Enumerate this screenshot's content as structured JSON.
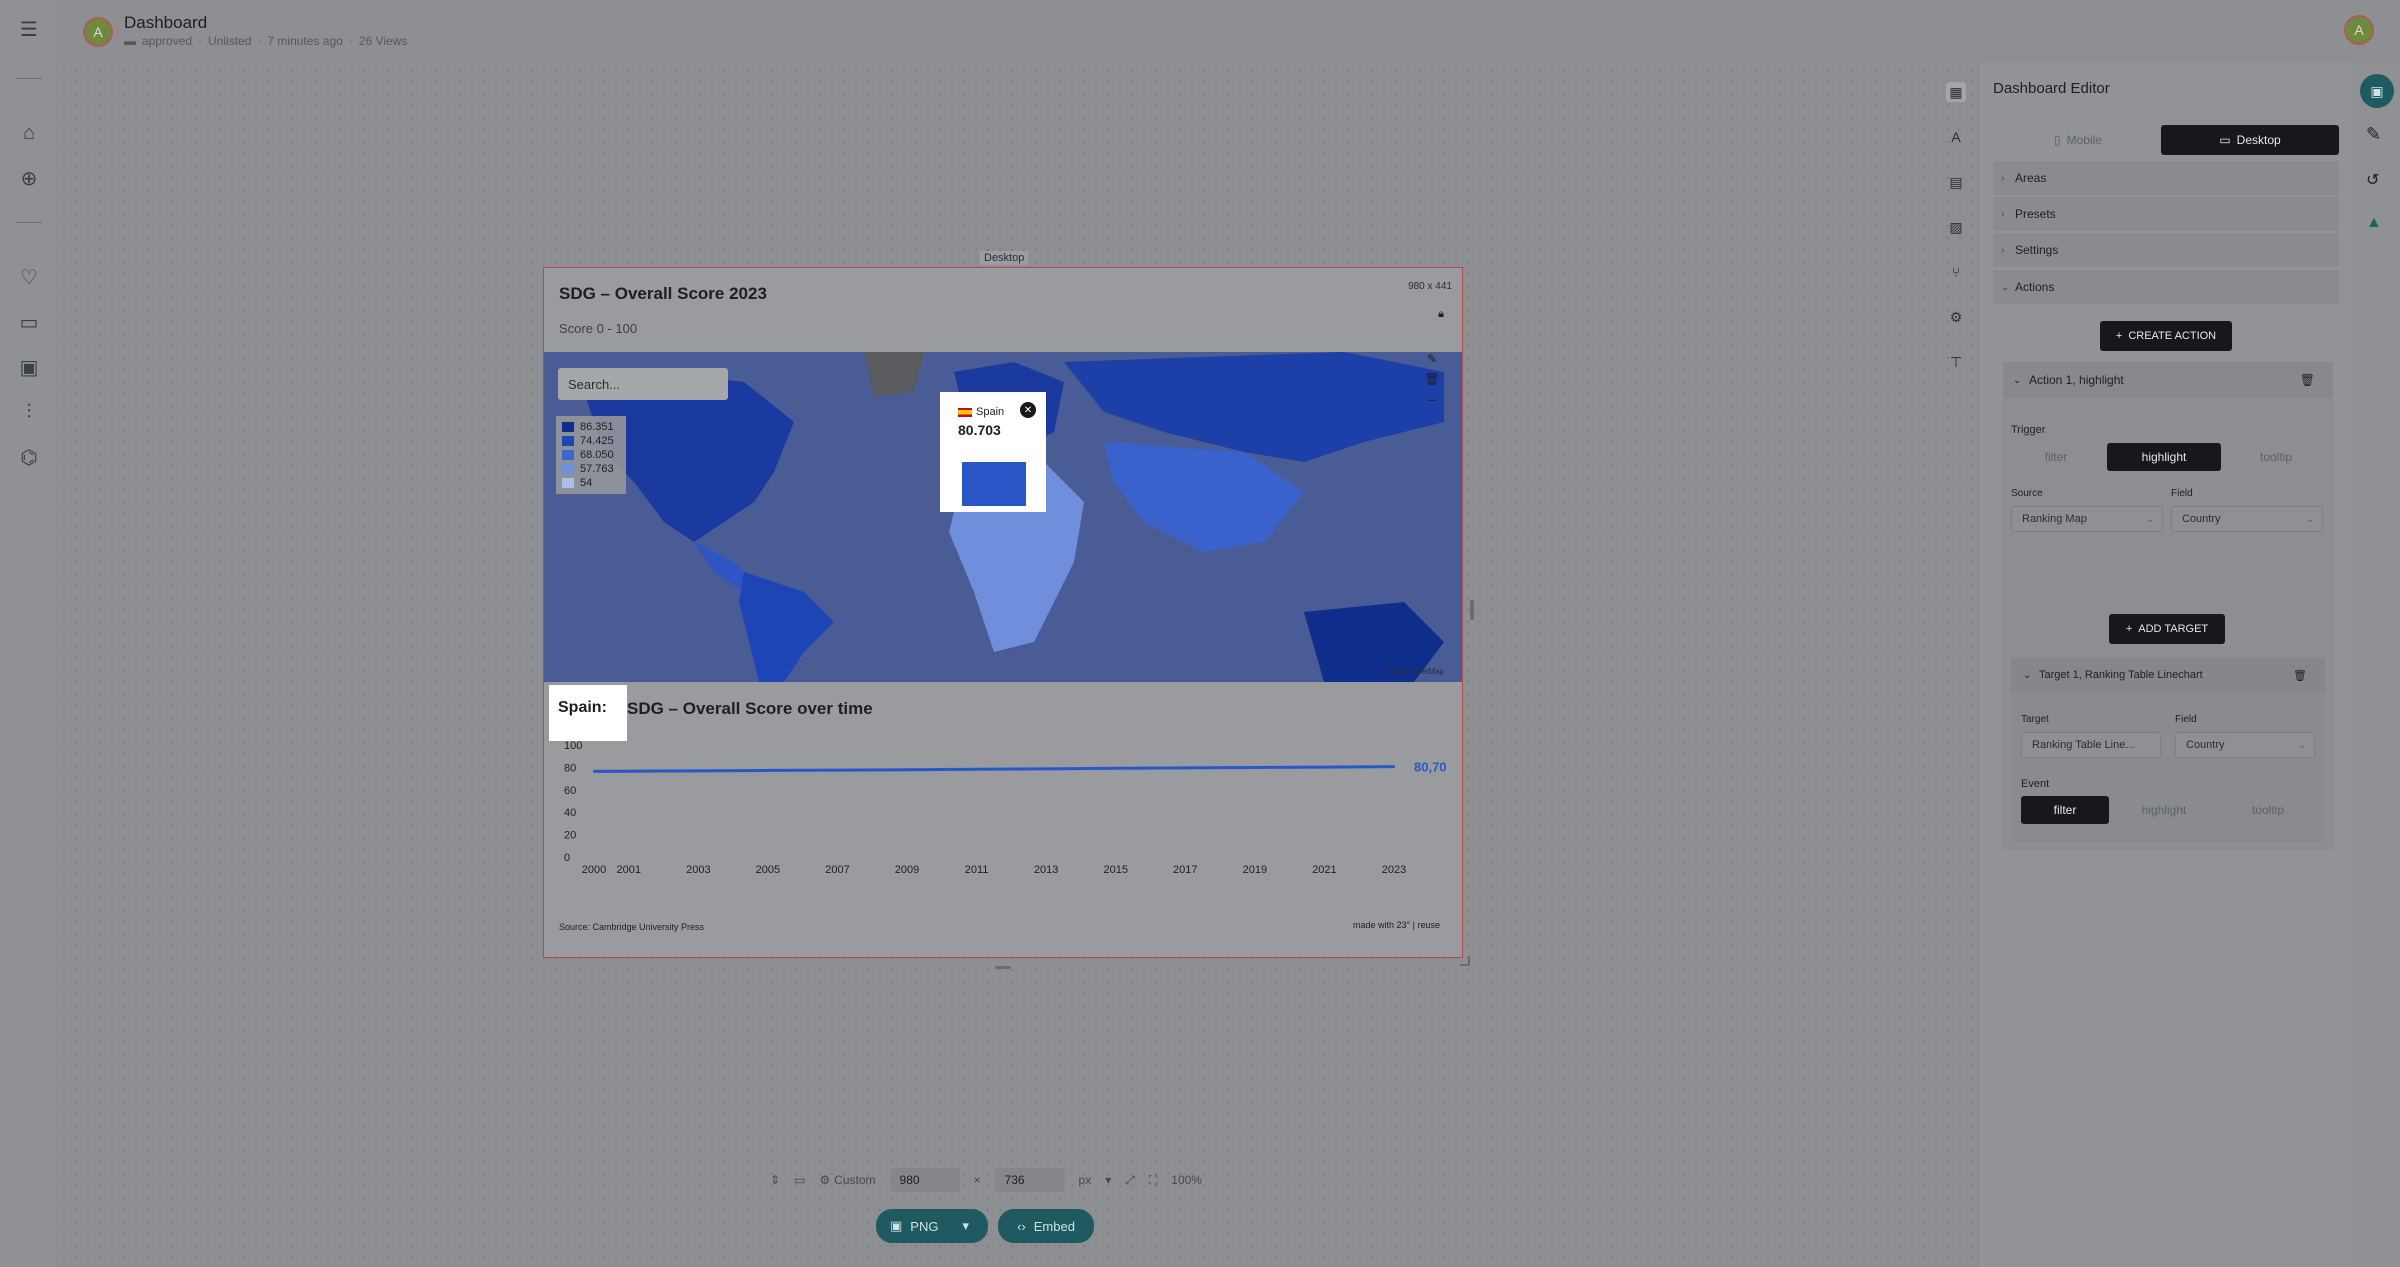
{
  "header": {
    "title": "Dashboard",
    "status": "approved",
    "visibility": "Unlisted",
    "updated": "7 minutes ago",
    "views": "26 Views",
    "avatar_initial": "A"
  },
  "canvas": {
    "viewport_label": "Desktop",
    "size_badge": "980 x 441"
  },
  "map_section": {
    "title": "SDG – Overall Score 2023",
    "subtitle": "Score 0 - 100",
    "search_placeholder": "Search...",
    "legend": [
      {
        "label": "86.351",
        "color": "#0f2d8a"
      },
      {
        "label": "74.425",
        "color": "#1e46b4"
      },
      {
        "label": "68.050",
        "color": "#3d68cf"
      },
      {
        "label": "57.763",
        "color": "#6e91dd"
      },
      {
        "label": "54",
        "color": "#a9bfe9"
      }
    ],
    "tooltip": {
      "country": "Spain",
      "value": "80.703"
    },
    "attribution": "OpenStreetMap"
  },
  "line_section": {
    "highlight_label": "Spain: ",
    "title": "SDG – Overall Score over time",
    "end_label": "80,70",
    "source": "Source: Cambridge University Press",
    "made_with": "made with 23° | reuse"
  },
  "chart_data": {
    "type": "line",
    "title": "SDG – Overall Score over time",
    "x": [
      2000,
      2001,
      2003,
      2005,
      2007,
      2009,
      2011,
      2013,
      2015,
      2017,
      2019,
      2021,
      2023
    ],
    "x_ticks": [
      "2000",
      "2001",
      "2003",
      "2005",
      "2007",
      "2009",
      "2011",
      "2013",
      "2015",
      "2017",
      "2019",
      "2021",
      "2023"
    ],
    "y_ticks": [
      "0",
      "20",
      "40",
      "60",
      "80",
      "100"
    ],
    "ylim": [
      0,
      100
    ],
    "series": [
      {
        "name": "Spain",
        "color": "#2a57c8",
        "values": [
          76.5,
          76.6,
          76.9,
          77.3,
          77.6,
          77.9,
          78.3,
          78.7,
          79.2,
          79.6,
          79.9,
          80.3,
          80.7
        ]
      }
    ],
    "grid": false
  },
  "toolbar": {
    "preset_label": "Custom",
    "width": "980",
    "times": "×",
    "height": "736",
    "unit": "px",
    "zoom": "100%",
    "png_label": "PNG",
    "embed_label": "Embed"
  },
  "editor": {
    "title": "Dashboard Editor",
    "tab_mobile": "Mobile",
    "tab_desktop": "Desktop",
    "sections": [
      "Areas",
      "Presets",
      "Settings",
      "Actions"
    ],
    "create_action": "CREATE ACTION",
    "action_title": "Action 1, highlight",
    "trigger_label": "Trigger",
    "trigger_options": [
      "filter",
      "highlight",
      "tooltip"
    ],
    "source_label": "Source",
    "source_value": "Ranking Map",
    "field_label": "Field",
    "field_value": "Country",
    "add_target": "ADD TARGET",
    "target_title": "Target 1, Ranking Table Linechart",
    "target_label": "Target",
    "target_value": "Ranking Table Line...",
    "target_field_label": "Field",
    "target_field_value": "Country",
    "event_label": "Event",
    "event_options": [
      "filter",
      "highlight",
      "tooltip"
    ]
  }
}
